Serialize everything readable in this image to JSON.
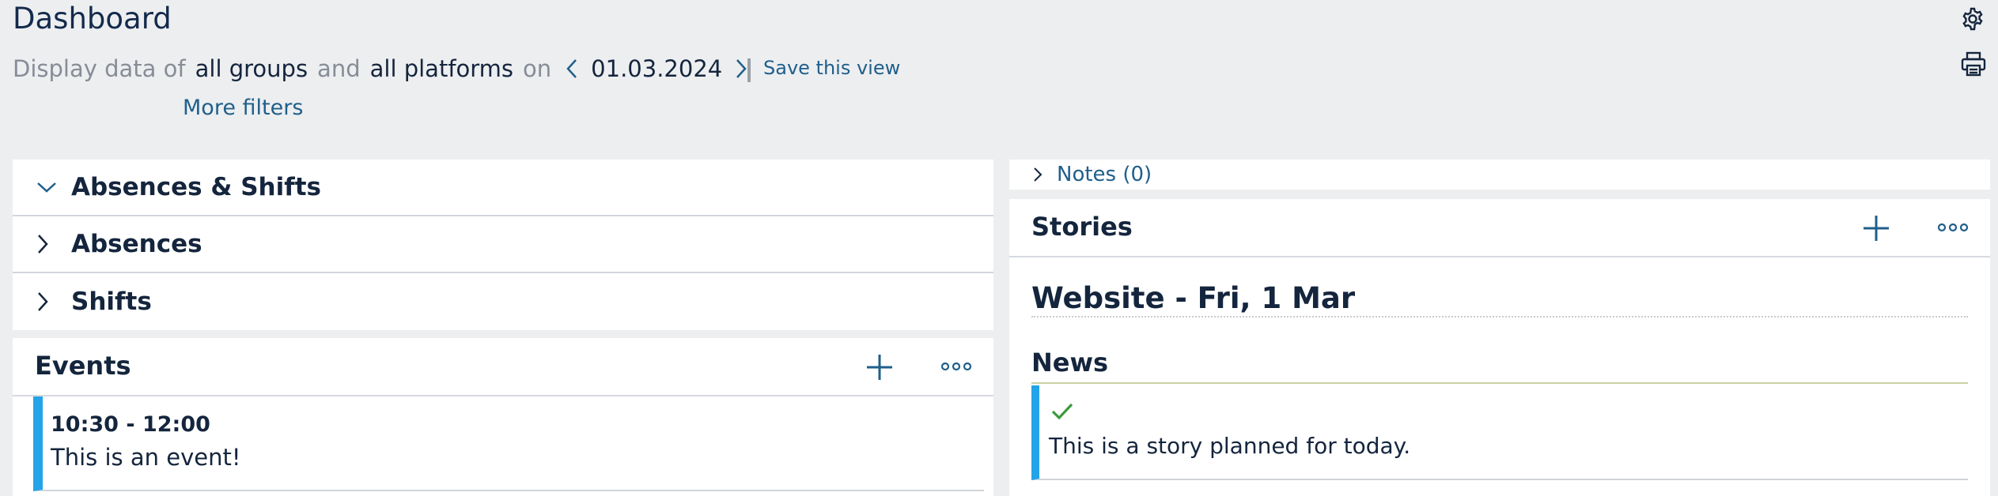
{
  "header": {
    "title": "Dashboard",
    "filter_prefix": "Display data of",
    "group_value": "all groups",
    "and_word": "and",
    "platform_value": "all platforms",
    "on_word": "on",
    "date": "01.03.2024",
    "save_view": "Save this view",
    "more_filters": "More filters",
    "icons": {
      "settings": "gear-icon",
      "print": "printer-icon",
      "prev": "chevron-left-icon",
      "next": "chevron-right-icon"
    }
  },
  "left": {
    "accordion": [
      {
        "label": "Absences & Shifts",
        "expanded": true
      },
      {
        "label": "Absences",
        "expanded": false
      },
      {
        "label": "Shifts",
        "expanded": false
      }
    ],
    "events": {
      "title": "Events",
      "items": [
        {
          "time": "10:30 - 12:00",
          "title": "This is an event!"
        }
      ]
    }
  },
  "right": {
    "notes": {
      "label": "Notes (0)"
    },
    "stories": {
      "title": "Stories",
      "day_heading": "Website - Fri, 1 Mar",
      "section": "News",
      "items": [
        {
          "status": "check-icon",
          "text": "This is a story planned for today."
        }
      ]
    }
  },
  "colors": {
    "background": "#edeef0",
    "accent": "#1f5f8b",
    "card_bar": "#23a3e8",
    "check": "#3a9a3a",
    "text": "#14253d"
  }
}
